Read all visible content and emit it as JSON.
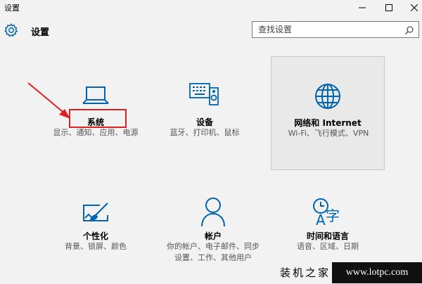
{
  "window": {
    "title": "设置",
    "controls": {
      "minimize": "minimize",
      "maximize": "maximize",
      "close": "close"
    }
  },
  "header": {
    "title": "设置",
    "search_placeholder": "查找设置"
  },
  "tiles": [
    {
      "id": "system",
      "name": "系统",
      "desc": "显示、通知、应用、电源",
      "icon": "laptop-icon"
    },
    {
      "id": "devices",
      "name": "设备",
      "desc": "蓝牙、打印机、鼠标",
      "icon": "devices-icon"
    },
    {
      "id": "network",
      "name": "网络和 Internet",
      "desc": "Wi-Fi、飞行模式、VPN",
      "icon": "globe-icon"
    },
    {
      "id": "personalization",
      "name": "个性化",
      "desc": "背景、锁屏、颜色",
      "icon": "paint-icon"
    },
    {
      "id": "accounts",
      "name": "帐户",
      "desc": "你的帐户、电子邮件、同步设置、工作、其他用户",
      "icon": "person-icon"
    },
    {
      "id": "time_language",
      "name": "时间和语言",
      "desc": "语音、区域、日期",
      "icon": "time-language-icon"
    }
  ],
  "accent_color": "#0063b1",
  "annotation_color": "#e02020",
  "watermark": {
    "cn": "装机之家",
    "url": "www.lotpc.com"
  }
}
